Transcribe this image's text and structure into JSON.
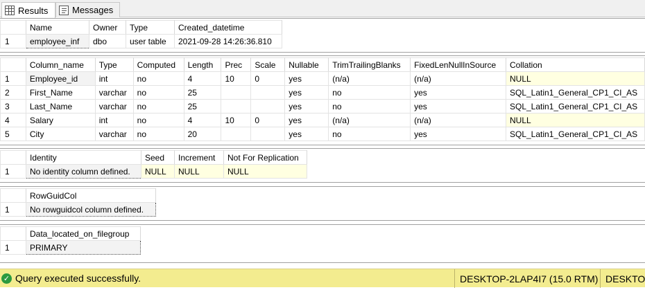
{
  "tabs": [
    {
      "label": "Results",
      "icon": "grid-icon",
      "active": true
    },
    {
      "label": "Messages",
      "icon": "messages-icon",
      "active": false
    }
  ],
  "grid1": {
    "headers": [
      "",
      "Name",
      "Owner",
      "Type",
      "Created_datetime"
    ],
    "rows": [
      [
        "1",
        "employee_inf",
        "dbo",
        "user table",
        "2021-09-28 14:26:36.810"
      ]
    ]
  },
  "grid2": {
    "headers": [
      "",
      "Column_name",
      "Type",
      "Computed",
      "Length",
      "Prec",
      "Scale",
      "Nullable",
      "TrimTrailingBlanks",
      "FixedLenNullInSource",
      "Collation"
    ],
    "rows": [
      [
        "1",
        "Employee_id",
        "int",
        "no",
        "4",
        "10",
        "0",
        "yes",
        "(n/a)",
        "(n/a)",
        "NULL"
      ],
      [
        "2",
        "First_Name",
        "varchar",
        "no",
        "25",
        "",
        "",
        "yes",
        "no",
        "yes",
        "SQL_Latin1_General_CP1_CI_AS"
      ],
      [
        "3",
        "Last_Name",
        "varchar",
        "no",
        "25",
        "",
        "",
        "yes",
        "no",
        "yes",
        "SQL_Latin1_General_CP1_CI_AS"
      ],
      [
        "4",
        "Salary",
        "int",
        "no",
        "4",
        "10",
        "0",
        "yes",
        "(n/a)",
        "(n/a)",
        "NULL"
      ],
      [
        "5",
        "City",
        "varchar",
        "no",
        "20",
        "",
        "",
        "yes",
        "no",
        "yes",
        "SQL_Latin1_General_CP1_CI_AS"
      ]
    ]
  },
  "grid3": {
    "headers": [
      "",
      "Identity",
      "Seed",
      "Increment",
      "Not For Replication"
    ],
    "rows": [
      [
        "1",
        "No identity column defined.",
        "NULL",
        "NULL",
        "NULL"
      ]
    ]
  },
  "grid4": {
    "headers": [
      "",
      "RowGuidCol"
    ],
    "rows": [
      [
        "1",
        "No rowguidcol column defined."
      ]
    ]
  },
  "grid5": {
    "headers": [
      "",
      "Data_located_on_filegroup"
    ],
    "rows": [
      [
        "1",
        "PRIMARY"
      ]
    ]
  },
  "status": {
    "message": "Query executed successfully.",
    "server": "DESKTOP-2LAP4I7 (15.0 RTM)",
    "server2": "DESKTOF",
    "color": "#f3ec8f"
  }
}
